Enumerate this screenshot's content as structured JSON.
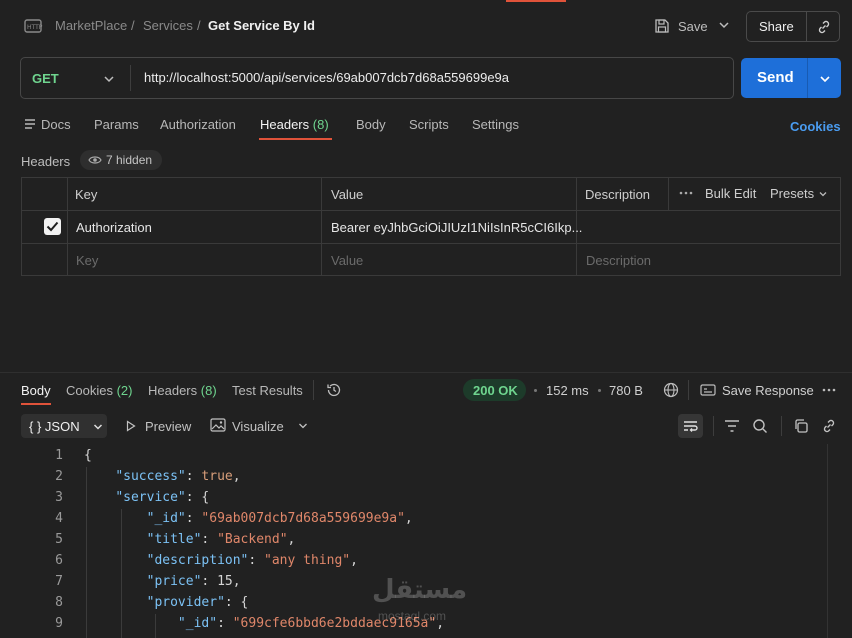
{
  "breadcrumb": {
    "collection": "MarketPlace",
    "folder": "Services",
    "separator": "/",
    "current": "Get Service By Id",
    "method_icon": "http-icon"
  },
  "toolbar": {
    "save_label": "Save",
    "share_label": "Share"
  },
  "request": {
    "method": "GET",
    "url": "http://localhost:5000/api/services/69ab007dcb7d68a559699e9a",
    "send_label": "Send"
  },
  "request_tabs": [
    {
      "label": "Docs",
      "count": ""
    },
    {
      "label": "Params",
      "count": ""
    },
    {
      "label": "Authorization",
      "count": ""
    },
    {
      "label": "Headers",
      "count": "(8)"
    },
    {
      "label": "Body",
      "count": ""
    },
    {
      "label": "Scripts",
      "count": ""
    },
    {
      "label": "Settings",
      "count": ""
    }
  ],
  "cookies_link": "Cookies",
  "headers_section": {
    "title": "Headers",
    "hidden_label": "7 hidden",
    "columns": {
      "key": "Key",
      "value": "Value",
      "description": "Description"
    },
    "bulk_edit": "Bulk Edit",
    "presets": "Presets",
    "rows": [
      {
        "key": "Authorization",
        "value": "Bearer eyJhbGciOiJIUzI1NiIsInR5cCI6Ikp...",
        "description": "",
        "checked": true
      }
    ],
    "placeholder": {
      "key": "Key",
      "value": "Value",
      "description": "Description"
    }
  },
  "response": {
    "tabs": [
      {
        "label": "Body",
        "count": ""
      },
      {
        "label": "Cookies",
        "count": "(2)"
      },
      {
        "label": "Headers",
        "count": "(8)"
      },
      {
        "label": "Test Results",
        "count": ""
      }
    ],
    "status": "200 OK",
    "time": "152 ms",
    "size": "780 B",
    "save_response": "Save Response",
    "format_label": "{ } JSON",
    "preview_label": "Preview",
    "visualize_label": "Visualize",
    "status_color": "#6fd58f"
  },
  "code_lines": [
    {
      "n": "1",
      "html": "{"
    },
    {
      "n": "2",
      "html": "    <span class='k'>\"success\"</span>: <span class='b'>true</span>,"
    },
    {
      "n": "3",
      "html": "    <span class='k'>\"service\"</span>: {"
    },
    {
      "n": "4",
      "html": "        <span class='k'>\"_id\"</span>: <span class='s'>\"69ab007dcb7d68a559699e9a\"</span>,"
    },
    {
      "n": "5",
      "html": "        <span class='k'>\"title\"</span>: <span class='s'>\"Backend\"</span>,"
    },
    {
      "n": "6",
      "html": "        <span class='k'>\"description\"</span>: <span class='s'>\"any thing\"</span>,"
    },
    {
      "n": "7",
      "html": "        <span class='k'>\"price\"</span>: <span class='n'>15</span>,"
    },
    {
      "n": "8",
      "html": "        <span class='k'>\"provider\"</span>: {"
    },
    {
      "n": "9",
      "html": "            <span class='k'>\"_id\"</span>: <span class='s'>\"699cfe6bbd6e2bddaec9165a\"</span>,"
    }
  ],
  "watermark": {
    "arabic": "مستقل",
    "latin": "mostaql.com"
  }
}
